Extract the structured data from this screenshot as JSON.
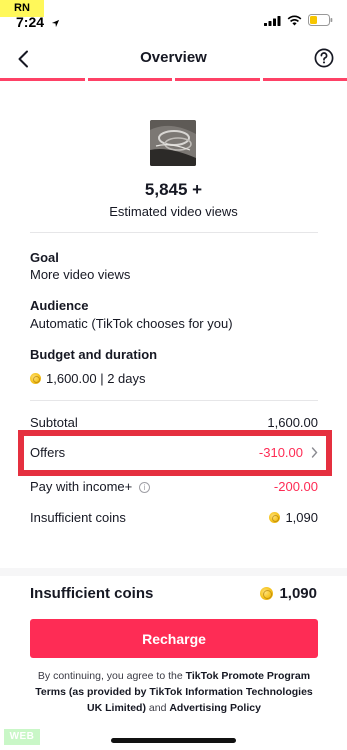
{
  "status_bar": {
    "badge": "RN",
    "time": "7:24"
  },
  "nav": {
    "title": "Overview"
  },
  "promotion": {
    "views": "5,845 +",
    "views_label": "Estimated video views"
  },
  "goal": {
    "title": "Goal",
    "value": "More video views"
  },
  "audience": {
    "title": "Audience",
    "value": "Automatic (TikTok chooses for you)"
  },
  "budget": {
    "title": "Budget and duration",
    "value": "1,600.00 | 2 days"
  },
  "summary": {
    "subtotal_label": "Subtotal",
    "subtotal_value": "1,600.00",
    "offers_label": "Offers",
    "offers_value": "-310.00",
    "income_label": "Pay with income+",
    "income_value": "-200.00",
    "insufficient_label": "Insufficient coins",
    "insufficient_value": "1,090"
  },
  "footer": {
    "label": "Insufficient coins",
    "amount": "1,090",
    "button": "Recharge",
    "terms_prefix": "By continuing, you agree to the ",
    "terms_link1": "TikTok Promote Program Terms (as provided by TikTok Information Technologies UK Limited)",
    "terms_and": " and ",
    "terms_link2": "Advertising Policy"
  },
  "web_badge": "WEB",
  "colors": {
    "accent": "#fe2c55",
    "highlight": "#e5303f",
    "coin": "#f5c21b"
  },
  "icons": [
    "location-arrow-icon",
    "signal-icon",
    "wifi-icon",
    "battery-icon",
    "back-chevron-icon",
    "help-icon",
    "coin-icon",
    "info-icon",
    "chevron-right-icon"
  ]
}
